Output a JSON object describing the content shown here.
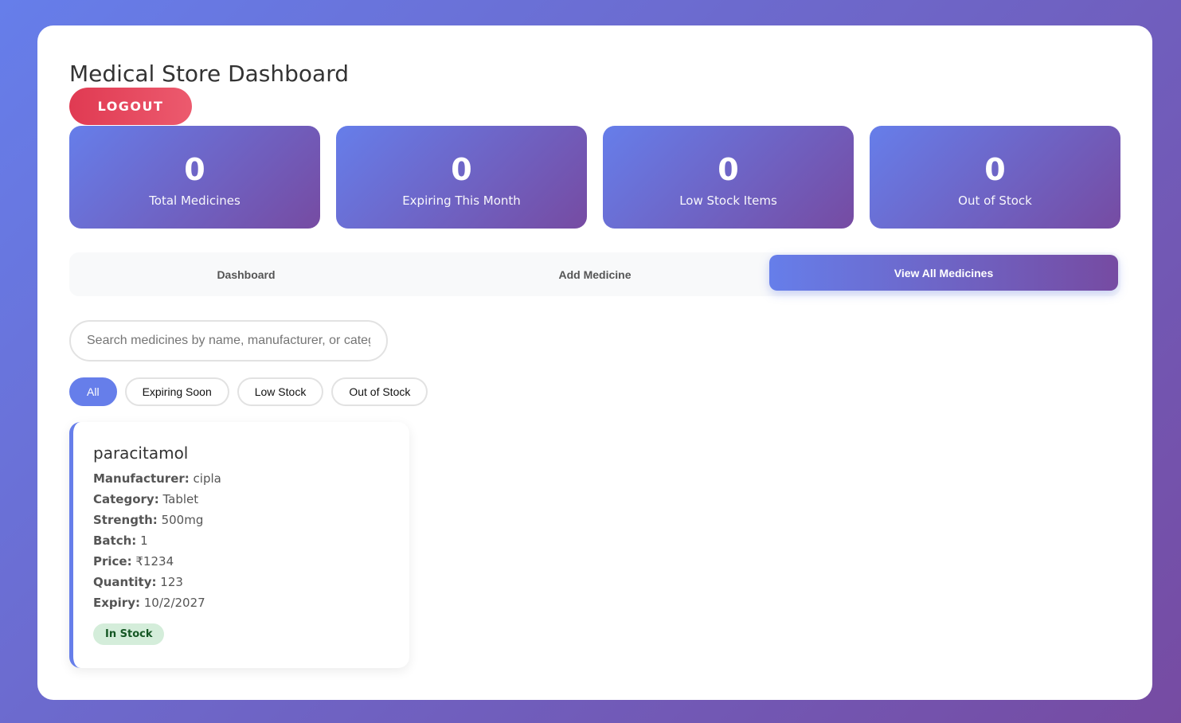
{
  "page": {
    "title": "Medical Store Dashboard",
    "logout_label": "LOGOUT"
  },
  "stats": [
    {
      "value": "0",
      "label": "Total Medicines"
    },
    {
      "value": "0",
      "label": "Expiring This Month"
    },
    {
      "value": "0",
      "label": "Low Stock Items"
    },
    {
      "value": "0",
      "label": "Out of Stock"
    }
  ],
  "tabs": [
    {
      "label": "Dashboard",
      "active": false
    },
    {
      "label": "Add Medicine",
      "active": false
    },
    {
      "label": "View All Medicines",
      "active": true
    }
  ],
  "search": {
    "value": "",
    "placeholder": "Search medicines by name, manufacturer, or category..."
  },
  "filters": [
    {
      "label": "All",
      "active": true
    },
    {
      "label": "Expiring Soon",
      "active": false
    },
    {
      "label": "Low Stock",
      "active": false
    },
    {
      "label": "Out of Stock",
      "active": false
    }
  ],
  "medicines": [
    {
      "name": "paracitamol",
      "fields": [
        {
          "label": "Manufacturer:",
          "value": "cipla"
        },
        {
          "label": "Category:",
          "value": "Tablet"
        },
        {
          "label": "Strength:",
          "value": "500mg"
        },
        {
          "label": "Batch:",
          "value": "1"
        },
        {
          "label": "Price:",
          "value": "₹1234"
        },
        {
          "label": "Quantity:",
          "value": "123"
        },
        {
          "label": "Expiry:",
          "value": "10/2/2027"
        }
      ],
      "status": "In Stock"
    }
  ],
  "colors": {
    "accent_start": "#667eea",
    "accent_end": "#764ba2",
    "logout": "#e03a52",
    "in_stock_bg": "#d4edda",
    "in_stock_text": "#155724"
  }
}
